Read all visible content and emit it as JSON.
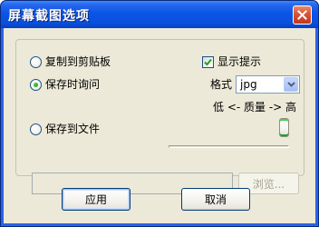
{
  "window": {
    "title": "屏幕截图选项",
    "close_icon": "close-icon"
  },
  "options": {
    "copy_to_clipboard": {
      "label": "复制到剪贴板",
      "selected": false
    },
    "save_on_ask": {
      "label": "保存时询问",
      "selected": true
    },
    "save_to_file": {
      "label": "保存到文件",
      "selected": false
    },
    "show_tips": {
      "label": "显示提示",
      "checked": true
    }
  },
  "format": {
    "label": "格式",
    "selected_value": "jpg"
  },
  "quality": {
    "label": "低 <- 质量 -> 高",
    "level": 1.0
  },
  "file_path": {
    "value": ""
  },
  "buttons": {
    "browse": "浏览...",
    "apply": "应用",
    "cancel": "取消"
  },
  "colors": {
    "title_bar": "#0a55e6",
    "dialog_bg": "#ece9d8",
    "radio_dot": "#21a121"
  }
}
